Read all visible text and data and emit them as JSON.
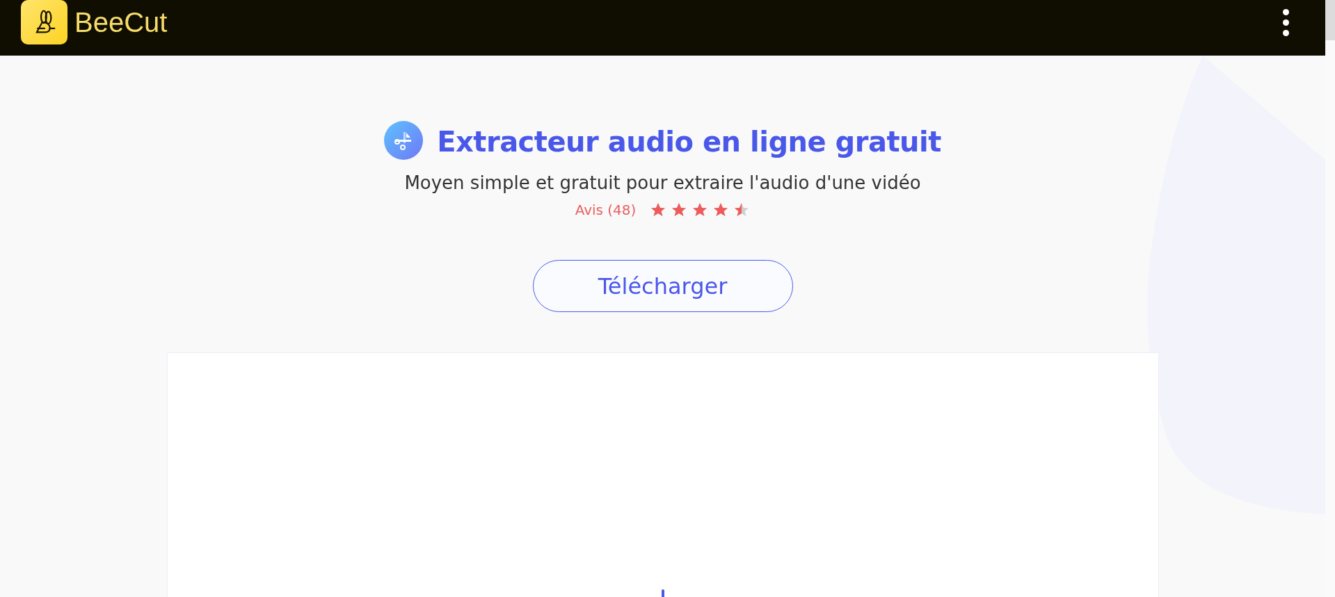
{
  "header": {
    "brand": "BeeCut"
  },
  "hero": {
    "title": "Extracteur audio en ligne gratuit",
    "subtitle": "Moyen simple et gratuit pour extraire l'audio d'une vidéo",
    "reviews": "Avis (48)",
    "stars": 4.5,
    "button": "Télécharger"
  }
}
